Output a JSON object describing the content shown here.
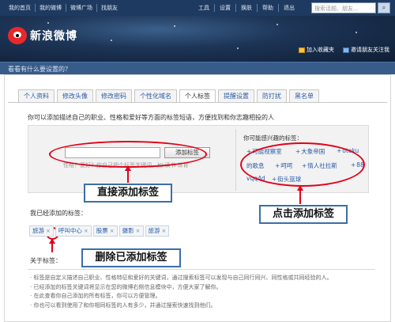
{
  "topbar": {
    "nav": [
      "我的首页",
      "我的微博",
      "微博广场",
      "找朋友"
    ],
    "right": [
      "工具",
      "设置",
      "换肤",
      "帮助",
      "退出"
    ],
    "search_placeholder": "搜索话题、朋友..."
  },
  "banner": {
    "logo_text": "新浪微博",
    "favorite": "加入收藏夹",
    "invite": "邀请朋友关注我"
  },
  "status_prompt": "看看有什么要设置的？",
  "tabs": [
    {
      "label": "个人资料",
      "active": false
    },
    {
      "label": "修改头像",
      "active": false
    },
    {
      "label": "修改密码",
      "active": false
    },
    {
      "label": "个性化域名",
      "active": false
    },
    {
      "label": "个人标签",
      "active": true
    },
    {
      "label": "提醒设置",
      "active": false
    },
    {
      "label": "防打扰",
      "active": false
    },
    {
      "label": "黑名单",
      "active": false
    }
  ],
  "intro": "你可以添加描述自己的职业、性格和爱好等方面的标签短语，方便找到和你志趣相投的人",
  "panel": {
    "add_button": "添加标签",
    "hint": "性格？爱好？你自己把个标签关键词，如:读书 体育",
    "interest_title": "你可能感兴趣的标签：",
    "suggestions": [
      "可能视察室",
      "大象帝国",
      "otoku",
      "的歌息",
      "呵呵",
      "情人社拉斯",
      "88",
      "vqq4d",
      "街头篮球"
    ]
  },
  "callouts": {
    "add_direct": "直接添加标签",
    "click_add": "点击添加标签",
    "delete": "删除已添加标签"
  },
  "added_title": "我已经添加的标签：",
  "added_tags": [
    "旅游",
    "呼叫中心",
    "股票",
    "摄影",
    "旅游"
  ],
  "about_title": "关于标签：",
  "about_bullets": [
    "· 标签是自定义描述自己职业、性格特征和爱好的关键词，通过搜索标签可以发现与自己同行同兴、同性格或共同经验的人。",
    "· 已经添加的标签关键词将显示在您的微博右侧信息模块中，方便大家了解你。",
    "· 在此查看你自己添加的所有标签，你可以方便管理。",
    "· 你也可以看到使用了和你相同标签的人有多少，并通过搜索快速找到他们。"
  ],
  "colors": {
    "accent_red": "#e2001a",
    "link_blue": "#2a5aa5",
    "header_navy": "#1f3a60"
  }
}
